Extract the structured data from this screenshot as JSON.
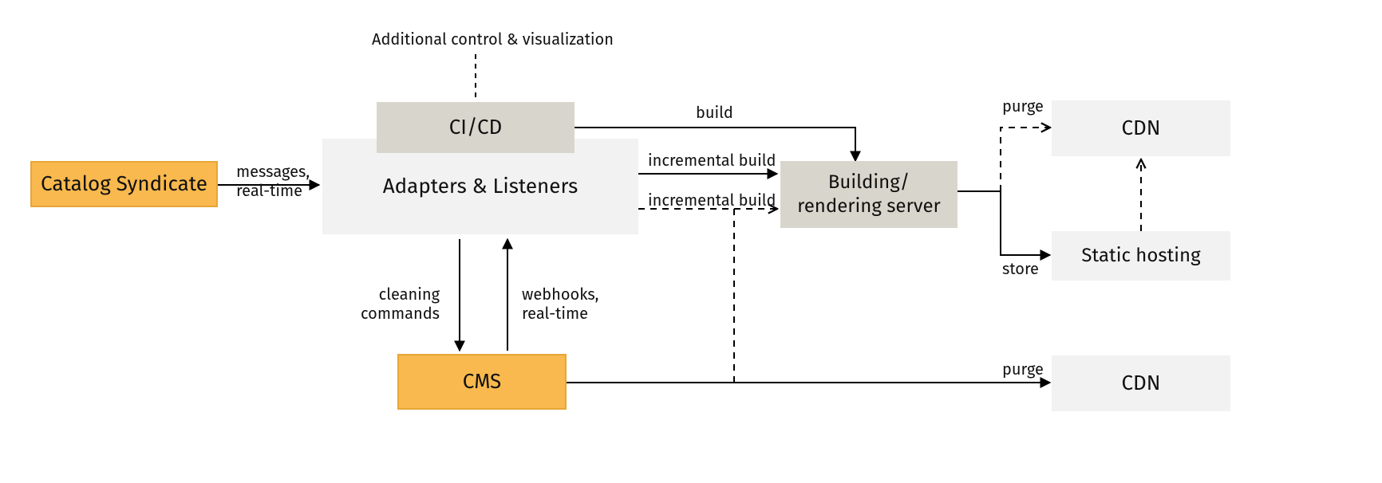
{
  "nodes": {
    "catalog": "Catalog Syndicate",
    "cicd": "CI/CD",
    "adapters": "Adapters & Listeners",
    "builder": "Building/\nrendering server",
    "cms": "CMS",
    "cdn_top": "CDN",
    "cdn_bottom": "CDN",
    "static_hosting": "Static hosting"
  },
  "labels": {
    "additional": "Additional control & visualization",
    "messages": "messages,\nreal-time",
    "build": "build",
    "inc_build_1": "incremental build",
    "inc_build_2": "incremental build",
    "cleaning": "cleaning\ncommands",
    "webhooks": "webhooks,\nreal-time",
    "purge_top": "purge",
    "store": "store",
    "purge_bottom": "purge"
  }
}
